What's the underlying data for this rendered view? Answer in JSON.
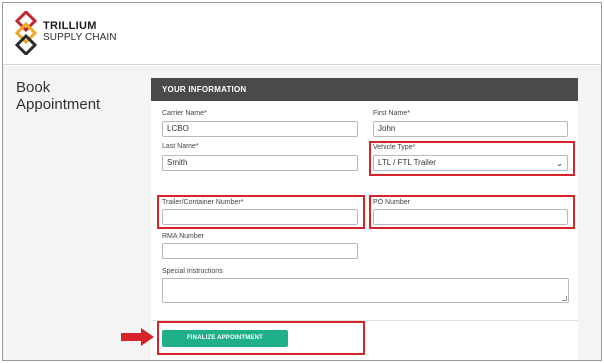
{
  "brand": {
    "line1": "TRILLIUM",
    "line2": "SUPPLY CHAIN",
    "colors": {
      "red": "#c0262d",
      "gold": "#f0a91e",
      "dark": "#2a2a2a"
    }
  },
  "page": {
    "title": "Book Appointment"
  },
  "form": {
    "section_title": "YOUR INFORMATION",
    "carrier_name": {
      "label": "Carrier Name*",
      "value": "LCBO"
    },
    "first_name": {
      "label": "First Name*",
      "value": "John"
    },
    "last_name": {
      "label": "Last Name*",
      "value": "Smith"
    },
    "vehicle_type": {
      "label": "Vehicle Type*",
      "value": "LTL / FTL Trailer",
      "caret": "⌄"
    },
    "trailer_number": {
      "label": "Trailer/Container Number*",
      "value": ""
    },
    "po_number": {
      "label": "PO Number",
      "value": ""
    },
    "rma_number": {
      "label": "RMA Number",
      "value": ""
    },
    "special_instructions": {
      "label": "Special Instructions",
      "value": ""
    },
    "finalize_button": "FINALIZE APPOINTMENT"
  },
  "annotation_color": "#d6242a",
  "accent_color": "#1fb08a"
}
